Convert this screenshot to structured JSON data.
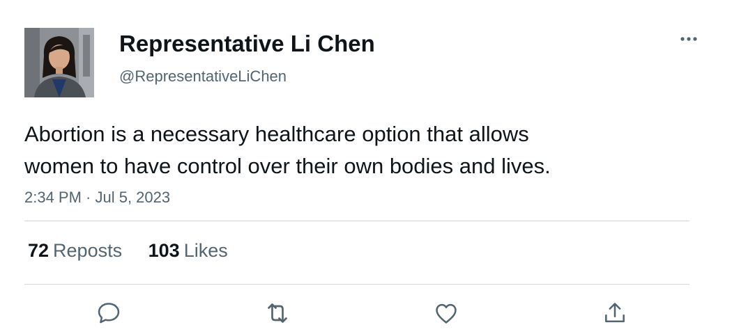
{
  "author": {
    "display_name": "Representative Li Chen",
    "handle": "@RepresentativeLiChen",
    "avatar": "profile-photo"
  },
  "tweet": {
    "text": "Abortion is a necessary healthcare option that allows\nwomen to have control over their own bodies and lives.",
    "timestamp": "2:34 PM · Jul 5, 2023"
  },
  "stats": {
    "reposts_count": "72",
    "reposts_label": "Reposts",
    "likes_count": "103",
    "likes_label": "Likes"
  },
  "actions": [
    {
      "icon": "reply-icon"
    },
    {
      "icon": "repost-icon"
    },
    {
      "icon": "like-icon"
    },
    {
      "icon": "share-icon"
    }
  ],
  "menu": {
    "icon": "more-options-icon"
  },
  "colors": {
    "text_primary": "#0f1419",
    "text_secondary": "#536471",
    "divider": "#cfd9de"
  }
}
